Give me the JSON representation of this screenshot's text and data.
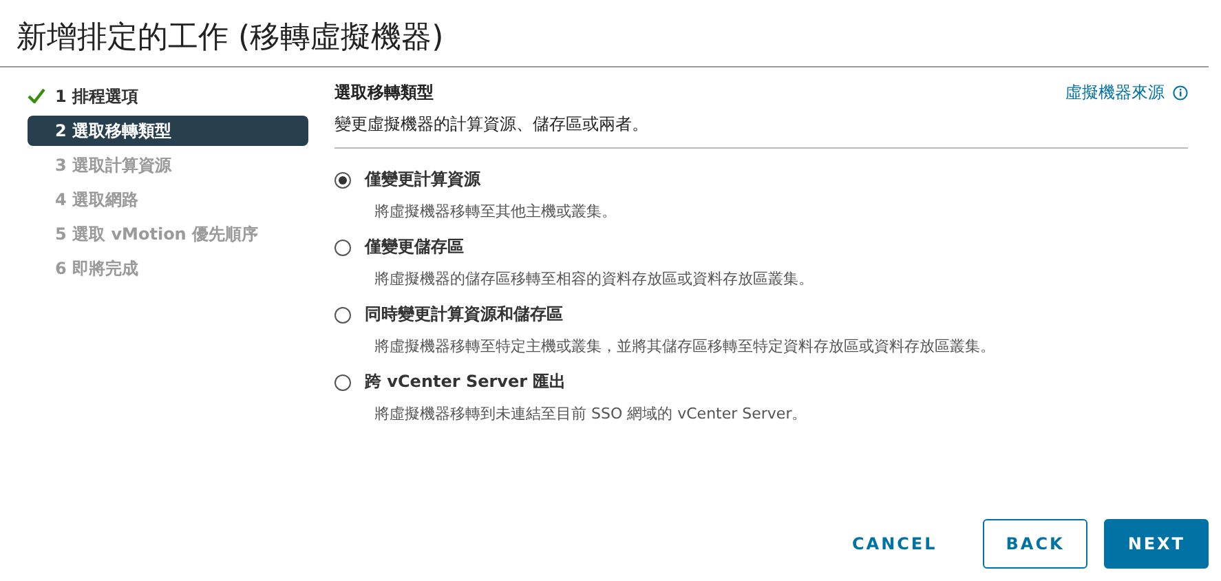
{
  "window": {
    "title": "新增排定的工作 (移轉虛擬機器)"
  },
  "steps": [
    {
      "label": "1 排程選項",
      "done": true,
      "selected": false,
      "disabled": false
    },
    {
      "label": "2 選取移轉類型",
      "done": false,
      "selected": true,
      "disabled": false
    },
    {
      "label": "3 選取計算資源",
      "done": false,
      "selected": false,
      "disabled": true
    },
    {
      "label": "4 選取網路",
      "done": false,
      "selected": false,
      "disabled": true
    },
    {
      "label": "5 選取 vMotion 優先順序",
      "done": false,
      "selected": false,
      "disabled": true
    },
    {
      "label": "6 即將完成",
      "done": false,
      "selected": false,
      "disabled": true
    }
  ],
  "content": {
    "heading": "選取移轉類型",
    "subtitle": "變更虛擬機器的計算資源、儲存區或兩者。",
    "source_link": "虛擬機器來源",
    "options": [
      {
        "label": "僅變更計算資源",
        "description": "將虛擬機器移轉至其他主機或叢集。",
        "selected": true
      },
      {
        "label": "僅變更儲存區",
        "description": "將虛擬機器的儲存區移轉至相容的資料存放區或資料存放區叢集。",
        "selected": false
      },
      {
        "label": "同時變更計算資源和儲存區",
        "description": "將虛擬機器移轉至特定主機或叢集，並將其儲存區移轉至特定資料存放區或資料存放區叢集。",
        "selected": false
      },
      {
        "label": "跨 vCenter Server 匯出",
        "description": "將虛擬機器移轉到未連結至目前 SSO 網域的 vCenter Server。",
        "selected": false
      }
    ]
  },
  "buttons": [
    {
      "label": "CANCEL",
      "kind": "flat"
    },
    {
      "label": "BACK",
      "kind": "outline"
    },
    {
      "label": "NEXT",
      "kind": "primary"
    }
  ]
}
